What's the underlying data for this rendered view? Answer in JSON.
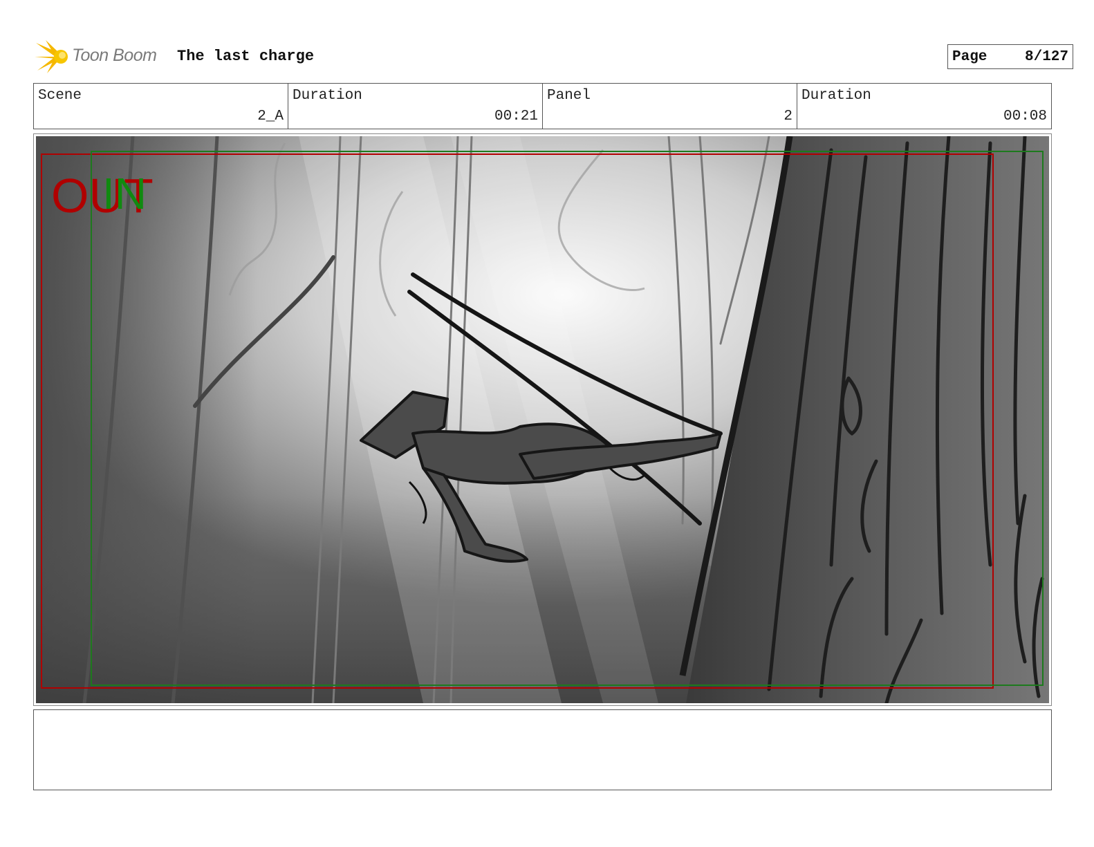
{
  "header": {
    "brand": "Toon Boom",
    "title": "The last charge",
    "page_label": "Page",
    "page_value": "8/127"
  },
  "info": [
    {
      "label": "Scene",
      "value": "2_A"
    },
    {
      "label": "Duration",
      "value": "00:21"
    },
    {
      "label": "Panel",
      "value": "2"
    },
    {
      "label": "Duration",
      "value": "00:08"
    }
  ],
  "panel": {
    "out_label": "OUT",
    "in_label": "IN",
    "out_color": "#b00000",
    "in_color": "#108a10"
  },
  "notes": {
    "text": ""
  }
}
